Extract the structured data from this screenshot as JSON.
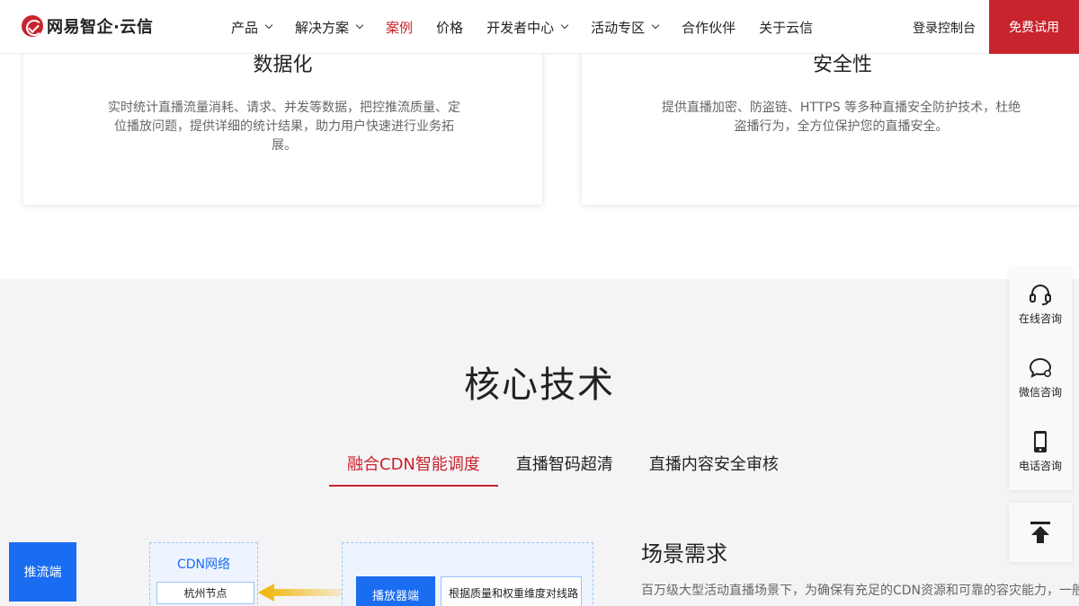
{
  "header": {
    "logo_text": "网易智企·云信",
    "nav": [
      {
        "label": "产品",
        "dropdown": true
      },
      {
        "label": "解决方案",
        "dropdown": true
      },
      {
        "label": "案例",
        "dropdown": false,
        "active": true
      },
      {
        "label": "价格",
        "dropdown": false
      },
      {
        "label": "开发者中心",
        "dropdown": true
      },
      {
        "label": "活动专区",
        "dropdown": true
      },
      {
        "label": "合作伙伴",
        "dropdown": false
      },
      {
        "label": "关于云信",
        "dropdown": false
      }
    ],
    "login_label": "登录控制台",
    "trial_label": "免费试用"
  },
  "cards": {
    "left": {
      "title": "数据化",
      "desc": "实时统计直播流量消耗、请求、并发等数据，把控推流质量、定位播放问题，提供详细的统计结果，助力用户快速进行业务拓展。"
    },
    "right": {
      "title": "安全性",
      "desc": "提供直播加密、防盗链、HTTPS 等多种直播安全防护技术，杜绝盗播行为，全方位保护您的直播安全。"
    }
  },
  "core": {
    "title": "核心技术",
    "tabs": [
      "融合CDN智能调度",
      "直播智码超清",
      "直播内容安全审核"
    ],
    "active_tab": 0,
    "diagram": {
      "push_label": "推流端",
      "cdn_label": "CDN网络",
      "node_label": "杭州节点",
      "player_label": "播放器端",
      "logic_label": "根据质量和权重维度对线路进行评分"
    },
    "requirement": {
      "title": "场景需求",
      "desc": "百万级大型活动直播场景下，为确保有充足的CDN资源和可靠的容灾能力，一般接入多家CDN服务商，而接入多家会带来商务对接成本和集成开发成本"
    }
  },
  "float_panel": {
    "items": [
      {
        "label": "在线咨询",
        "icon": "headset-icon"
      },
      {
        "label": "微信咨询",
        "icon": "wechat-icon"
      },
      {
        "label": "电话咨询",
        "icon": "phone-icon"
      }
    ],
    "top_icon": "back-to-top-icon"
  },
  "colors": {
    "brand_red": "#c8242d",
    "accent_blue": "#1a6cf0",
    "section_bg": "#f4f4f6"
  }
}
